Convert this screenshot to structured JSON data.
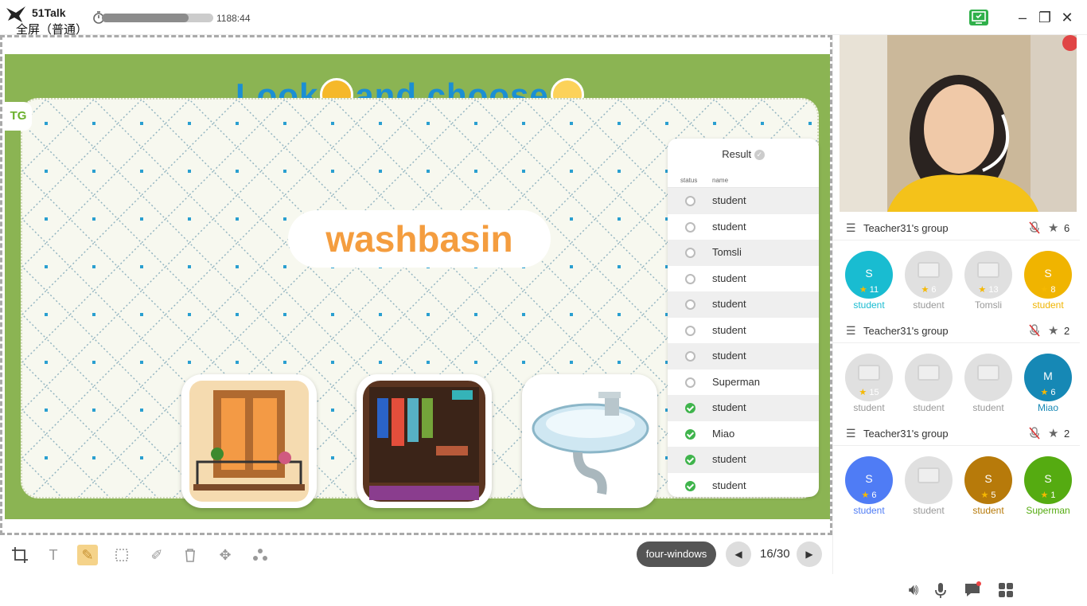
{
  "titlebar": {
    "app_name": "51Talk",
    "fullscreen_label": "全屏（普通）",
    "elapsed": "1188:44",
    "progress": 0.78
  },
  "slide": {
    "title_part1": "Look",
    "title_part2": "and choose",
    "title_end": ".",
    "tg_label": "TG",
    "word": "washbasin"
  },
  "result": {
    "title": "Result",
    "col_status": "status",
    "col_name": "name",
    "rows": [
      {
        "name": "student",
        "done": false
      },
      {
        "name": "student",
        "done": false
      },
      {
        "name": "Tomsli",
        "done": false
      },
      {
        "name": "student",
        "done": false
      },
      {
        "name": "student",
        "done": false
      },
      {
        "name": "student",
        "done": false
      },
      {
        "name": "student",
        "done": false
      },
      {
        "name": "Superman",
        "done": false
      },
      {
        "name": "student",
        "done": true
      },
      {
        "name": "Miao",
        "done": true
      },
      {
        "name": "student",
        "done": true
      },
      {
        "name": "student",
        "done": true
      }
    ]
  },
  "toolbar": {
    "mode_label": "four-windows",
    "page": "16/30"
  },
  "groups": [
    {
      "name": "Teacher31's group",
      "count": "6",
      "members": [
        {
          "initial": "S",
          "score": "11",
          "label": "student",
          "color": "#19bcd1",
          "online": true
        },
        {
          "initial": "",
          "score": "6",
          "label": "student",
          "color": "",
          "online": false
        },
        {
          "initial": "",
          "score": "13",
          "label": "Tomsli",
          "color": "",
          "online": false
        },
        {
          "initial": "S",
          "score": "8",
          "label": "student",
          "color": "#f0b400",
          "online": true
        }
      ]
    },
    {
      "name": "Teacher31's group",
      "count": "2",
      "members": [
        {
          "initial": "",
          "score": "15",
          "label": "student",
          "color": "",
          "online": false
        },
        {
          "initial": "",
          "score": "",
          "label": "student",
          "color": "",
          "online": false
        },
        {
          "initial": "",
          "score": "",
          "label": "student",
          "color": "",
          "online": false
        },
        {
          "initial": "M",
          "score": "6",
          "label": "Miao",
          "color": "#1688b5",
          "online": true
        }
      ]
    },
    {
      "name": "Teacher31's group",
      "count": "2",
      "members": [
        {
          "initial": "S",
          "score": "6",
          "label": "student",
          "color": "#4f7cf5",
          "online": true
        },
        {
          "initial": "",
          "score": "",
          "label": "student",
          "color": "",
          "online": false
        },
        {
          "initial": "S",
          "score": "5",
          "label": "student",
          "color": "#b77a0a",
          "online": true
        },
        {
          "initial": "S",
          "score": "1",
          "label": "Superman",
          "color": "#55ab11",
          "online": true
        }
      ]
    }
  ]
}
